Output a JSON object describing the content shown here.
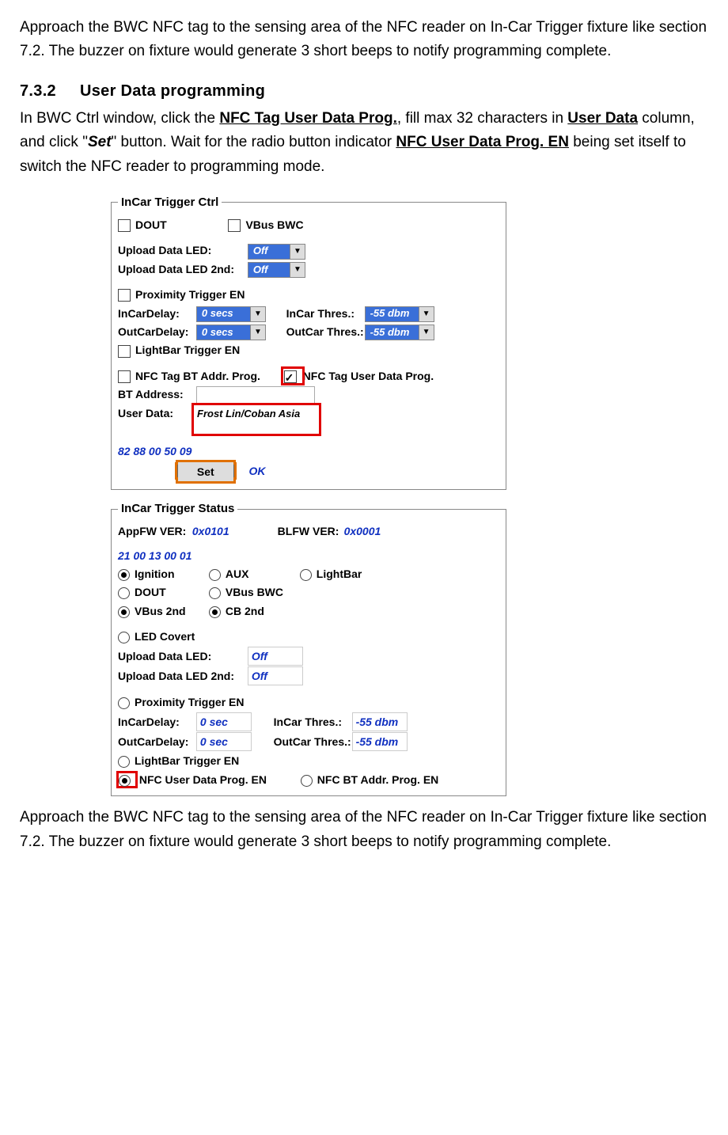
{
  "para1": "Approach the BWC NFC tag to the sensing area of the NFC reader on In-Car Trigger fixture like section 7.2. The buzzer on fixture would generate 3 short beeps to notify programming complete.",
  "section": {
    "num": "7.3.2",
    "title": "User Data programming"
  },
  "para2a": "In BWC Ctrl window, click the ",
  "para2_link1": "NFC Tag User Data Prog.",
  "para2b": ", fill max 32 characters in ",
  "para2_link2": "User Data",
  "para2c": " column, and click \"",
  "para2_btn": "Set",
  "para2d": "\" button. Wait for the radio button indicator ",
  "para2_link3": "NFC User Data Prog. EN",
  "para2e": " being set itself to switch the NFC reader to programming mode.",
  "ctrl": {
    "legend": "InCar Trigger Ctrl",
    "dout": "DOUT",
    "vbus": "VBus BWC",
    "upload_led_lbl": "Upload Data LED:",
    "upload_led_val": "Off",
    "upload_led2_lbl": "Upload Data LED 2nd:",
    "upload_led2_val": "Off",
    "prox": "Proximity Trigger EN",
    "incardelay_lbl": "InCarDelay:",
    "incardelay_val": "0 secs",
    "incarthres_lbl": "InCar Thres.:",
    "incarthres_val": "-55 dbm",
    "outcardelay_lbl": "OutCarDelay:",
    "outcardelay_val": "0 secs",
    "outcarthres_lbl": "OutCar Thres.:",
    "outcarthres_val": "-55 dbm",
    "lightbar": "LightBar Trigger EN",
    "nfc_bt": "NFC Tag BT Addr. Prog.",
    "nfc_user": "NFC Tag User Data Prog.",
    "btaddr_lbl": "BT Address:",
    "btaddr_val": "",
    "userdata_lbl": "User Data:",
    "userdata_val": "Frost Lin/Coban Asia",
    "hex": "82 88 00 50 09",
    "setbtn": "Set",
    "ok": "OK"
  },
  "status": {
    "legend": "InCar Trigger Status",
    "appfw_lbl": "AppFW VER:",
    "appfw_val": "0x0101",
    "blfw_lbl": "BLFW VER:",
    "blfw_val": "0x0001",
    "hex": "21 00 13 00 01",
    "ignition": "Ignition",
    "aux": "AUX",
    "lightbar": "LightBar",
    "dout": "DOUT",
    "vbus": "VBus BWC",
    "vbus2": "VBus 2nd",
    "cb2": "CB 2nd",
    "ledcovert": "LED Covert",
    "upload_led_lbl": "Upload Data LED:",
    "upload_led_val": "Off",
    "upload_led2_lbl": "Upload Data LED 2nd:",
    "upload_led2_val": "Off",
    "prox": "Proximity Trigger EN",
    "incardelay_lbl": "InCarDelay:",
    "incardelay_val": "0 sec",
    "incarthres_lbl": "InCar Thres.:",
    "incarthres_val": "-55 dbm",
    "outcardelay_lbl": "OutCarDelay:",
    "outcardelay_val": "0 sec",
    "outcarthres_lbl": "OutCar Thres.:",
    "outcarthres_val": "-55 dbm",
    "lightbar_trig": "LightBar Trigger EN",
    "nfc_user_en": "NFC User Data Prog. EN",
    "nfc_bt_en": "NFC BT Addr. Prog. EN"
  },
  "para3": "Approach the BWC NFC tag to the sensing area of the NFC reader on In-Car Trigger fixture like section 7.2. The buzzer on fixture would generate 3 short beeps to notify programming complete."
}
